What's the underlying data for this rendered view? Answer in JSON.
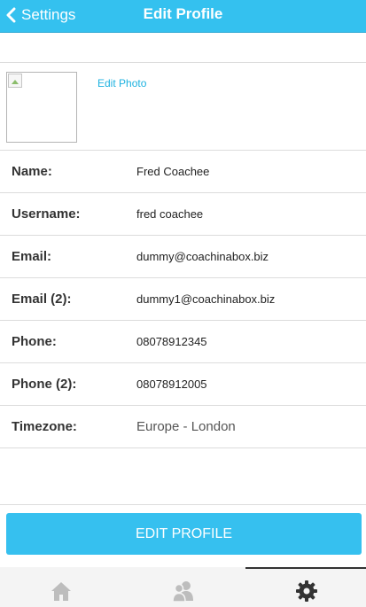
{
  "nav": {
    "back_label": "Settings",
    "title": "Edit Profile"
  },
  "photo": {
    "edit_label": "Edit Photo"
  },
  "fields": [
    {
      "label": "Name:",
      "value": "Fred Coachee"
    },
    {
      "label": "Username:",
      "value": "fred coachee"
    },
    {
      "label": "Email:",
      "value": "dummy@coachinabox.biz"
    },
    {
      "label": "Email (2):",
      "value": "dummy1@coachinabox.biz"
    },
    {
      "label": "Phone:",
      "value": "08078912345"
    },
    {
      "label": "Phone (2):",
      "value": "08078912005"
    },
    {
      "label": "Timezone:",
      "value": "Europe - London"
    }
  ],
  "button": {
    "edit_profile_label": "EDIT PROFILE"
  },
  "tabbar": {
    "tabs": [
      {
        "icon": "home-icon",
        "active": false
      },
      {
        "icon": "people-icon",
        "active": false
      },
      {
        "icon": "gear-icon",
        "active": true
      }
    ]
  },
  "colors": {
    "accent": "#34c1ef",
    "link": "#1eb2e0",
    "divider": "#dcdcdc"
  }
}
